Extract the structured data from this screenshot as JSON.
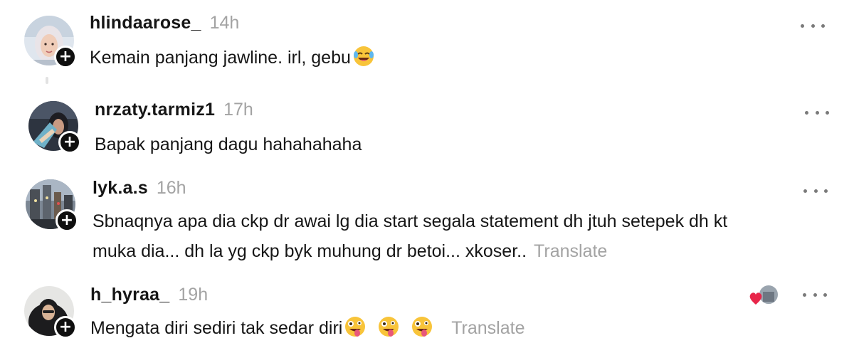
{
  "comments": [
    {
      "username": "hlindaarose_",
      "time": "14h",
      "text": "Kemain panjang jawline. irl, gebu",
      "emoji": "laughing-tears",
      "translate": ""
    },
    {
      "username": "nrzaty.tarmiz1",
      "time": "17h",
      "text": "Bapak panjang dagu hahahahaha",
      "translate": ""
    },
    {
      "username": "lyk.a.s",
      "time": "16h",
      "text_line1": "Sbnaqnya apa dia ckp dr awai lg dia start segala statement dh jtuh setepek dh kt",
      "text_line2": "muka dia... dh la yg ckp byk muhung dr betoi... xkoser..",
      "translate": "Translate"
    },
    {
      "username": "h_hyraa_",
      "time": "19h",
      "text": "Mengata diri sediri tak sedar diri",
      "emoji": "zany-face",
      "translate": "Translate"
    }
  ],
  "icons": {
    "follow": "plus-icon",
    "more": "more-options-icon",
    "reaction": "heart-icon"
  },
  "colors": {
    "text": "#161616",
    "muted": "#a3a3a3",
    "heart": "#e8264a",
    "badge": "#0f0f0f"
  }
}
